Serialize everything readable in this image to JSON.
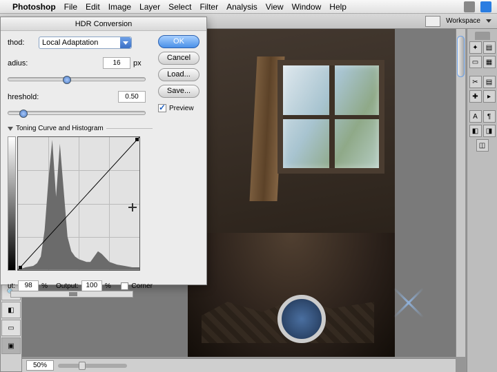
{
  "menubar": {
    "app": "Photoshop",
    "items": [
      "File",
      "Edit",
      "Image",
      "Layer",
      "Select",
      "Filter",
      "Analysis",
      "View",
      "Window",
      "Help"
    ]
  },
  "options_bar": {
    "workspace_label": "Workspace"
  },
  "dialog": {
    "title": "HDR Conversion",
    "method_label": "thod:",
    "method_value": "Local Adaptation",
    "radius_label": "adius:",
    "radius_value": "16",
    "radius_unit": "px",
    "threshold_label": "hreshold:",
    "threshold_value": "0.50",
    "buttons": {
      "ok": "OK",
      "cancel": "Cancel",
      "load": "Load...",
      "save": "Save..."
    },
    "preview_label": "Preview",
    "section_title": "Toning Curve and Histogram",
    "input_label": "ut:",
    "input_value": "98",
    "input_unit": "%",
    "output_label": "Output:",
    "output_value": "100",
    "output_unit": "%",
    "corner_label": "Corner",
    "radius_slider_pos": 40,
    "threshold_slider_pos": 8
  },
  "status": {
    "zoom": "50%"
  },
  "chart_data": {
    "type": "area",
    "title": "Toning Curve and Histogram",
    "xlabel": "",
    "ylabel": "",
    "xlim": [
      0,
      255
    ],
    "ylim": [
      0,
      100
    ],
    "series": [
      {
        "name": "histogram",
        "type": "area",
        "x": [
          0,
          16,
          32,
          40,
          48,
          56,
          64,
          72,
          80,
          88,
          96,
          104,
          112,
          120,
          128,
          136,
          144,
          152,
          160,
          168,
          176,
          192,
          208,
          224,
          240,
          255
        ],
        "values": [
          0,
          2,
          3,
          5,
          10,
          30,
          68,
          98,
          55,
          95,
          60,
          25,
          14,
          10,
          8,
          7,
          6,
          6,
          10,
          14,
          12,
          6,
          4,
          3,
          2,
          2
        ]
      },
      {
        "name": "toning-curve",
        "type": "line",
        "x": [
          0,
          255
        ],
        "values": [
          0,
          100
        ]
      }
    ]
  }
}
